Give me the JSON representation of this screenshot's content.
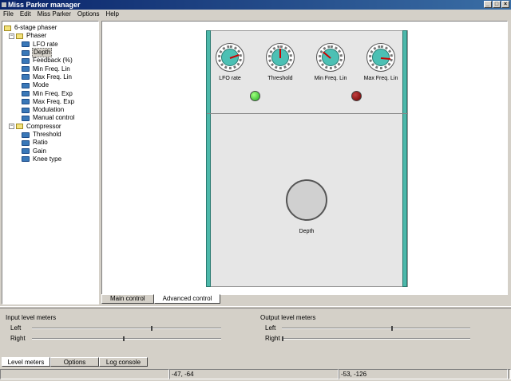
{
  "window": {
    "title": "Miss Parker manager",
    "controls": [
      "_",
      "□",
      "×"
    ]
  },
  "menu": [
    "File",
    "Edit",
    "Miss Parker",
    "Options",
    "Help"
  ],
  "tree": {
    "root": "6-stage phaser",
    "groups": [
      {
        "label": "Phaser",
        "items": [
          "LFO rate",
          "Depth",
          "Feedback (%)",
          "Min Freq. Lin",
          "Max Freq. Lin",
          "Mode",
          "Min Freq. Exp",
          "Max Freq. Exp",
          "Modulation",
          "Manual control"
        ]
      },
      {
        "label": "Compressor",
        "items": [
          "Threshold",
          "Ratio",
          "Gain",
          "Knee type"
        ]
      }
    ],
    "selected": "Depth"
  },
  "pedal": {
    "knobs": [
      {
        "label": "LFO rate",
        "angle": -20
      },
      {
        "label": "Threshold",
        "angle": -90
      },
      {
        "label": "Min Freq. Lin",
        "angle": -140
      },
      {
        "label": "Max Freq. Lin",
        "angle": 5
      }
    ],
    "leds": [
      {
        "color": "#22b022",
        "state": "on"
      },
      {
        "color": "#700000",
        "state": "off"
      }
    ],
    "button_label": "Depth"
  },
  "main_tabs": [
    "Main control",
    "Advanced control"
  ],
  "meters": {
    "input": {
      "title": "Input level meters",
      "left_label": "Left",
      "right_label": "Right",
      "left_value": 0.63,
      "right_value": 0.48
    },
    "output": {
      "title": "Output level meters",
      "left_label": "Left",
      "right_label": "Right",
      "left_value": 0.58,
      "right_value": 0.0
    }
  },
  "bottom_tabs": [
    "Level meters",
    "Options",
    "Log console"
  ],
  "status": [
    "",
    "-47, -64",
    "-53, -126",
    ""
  ]
}
